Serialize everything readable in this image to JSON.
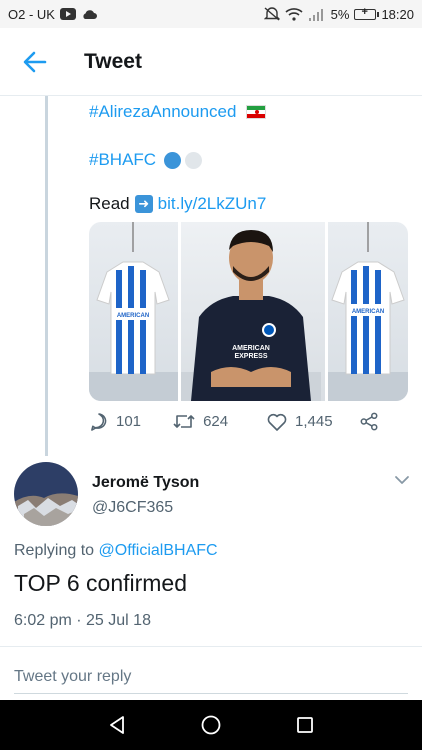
{
  "status_bar": {
    "carrier": "O2 - UK",
    "battery": "5%",
    "time": "18:20"
  },
  "header": {
    "title": "Tweet"
  },
  "tweet": {
    "hashtag1": "#AlirezaAnnounced",
    "hashtag2": "#BHAFC",
    "read_label": "Read",
    "link": "bit.ly/2LkZUn7",
    "replies": "101",
    "retweets": "624",
    "likes": "1,445"
  },
  "reply": {
    "display_name": "Jeromë Tyson",
    "handle": "@J6CF365",
    "replying_to_label": "Replying to",
    "replying_to_mention": "@OfficialBHAFC",
    "text": "TOP 6 confirmed",
    "timestamp": "6:02 pm · 25 Jul 18"
  },
  "compose": {
    "placeholder": "Tweet your reply"
  },
  "colors": {
    "accent": "#1d9bf0",
    "muted": "#536471",
    "brighton_blue": "#0057b8"
  },
  "icons": {
    "back": "arrow-left-icon",
    "reply": "comment-icon",
    "retweet": "retweet-icon",
    "like": "heart-icon",
    "share": "share-icon",
    "caret": "chevron-down-icon",
    "nav_back": "triangle-back-icon",
    "nav_home": "circle-home-icon",
    "nav_recent": "square-recents-icon"
  }
}
